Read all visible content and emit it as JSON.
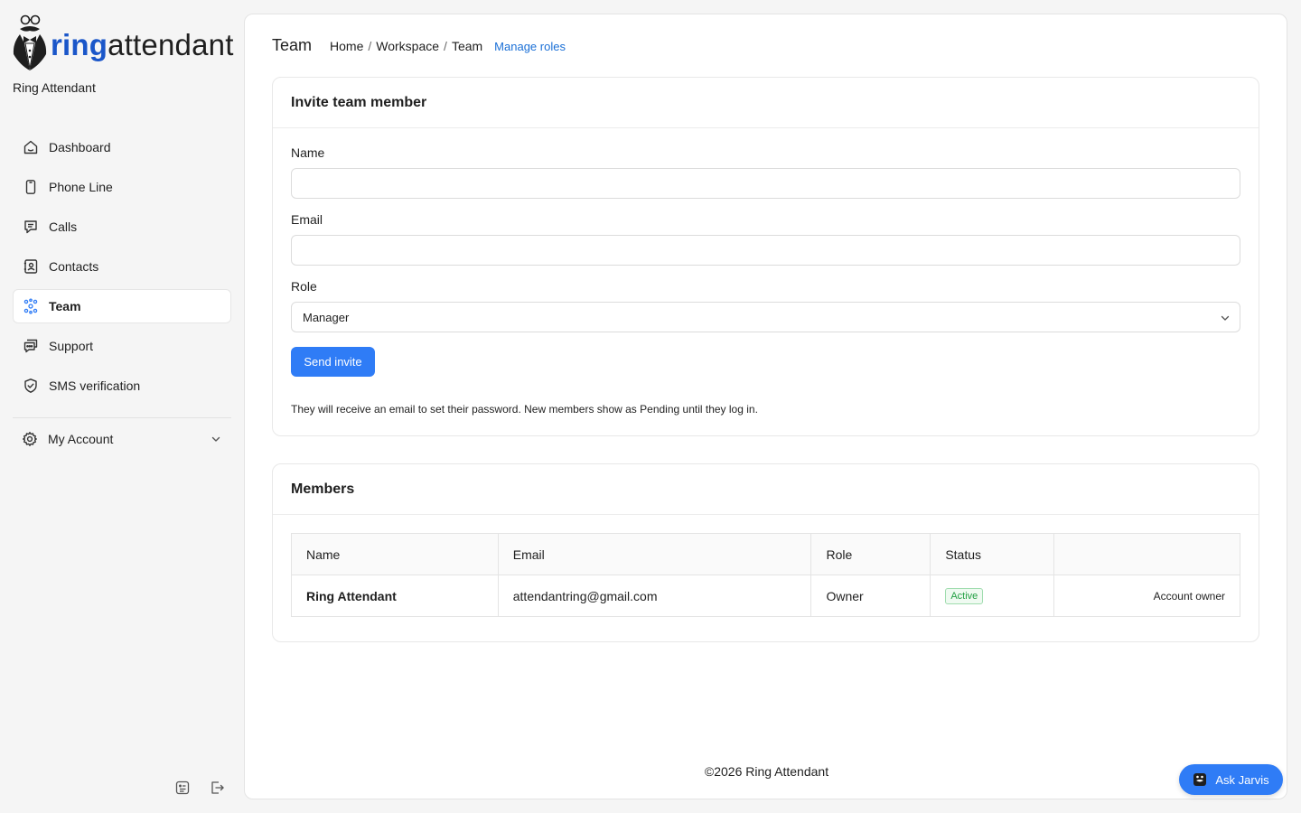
{
  "brand": {
    "logo_text_ring": "ring",
    "logo_text_attendant": "attendant",
    "org_name": "Ring Attendant",
    "accent_color": "#1a56c9"
  },
  "sidebar": {
    "items": [
      {
        "label": "Dashboard",
        "icon": "home-icon",
        "active": false
      },
      {
        "label": "Phone Line",
        "icon": "phone-icon",
        "active": false
      },
      {
        "label": "Calls",
        "icon": "message-icon",
        "active": false
      },
      {
        "label": "Contacts",
        "icon": "contact-icon",
        "active": false
      },
      {
        "label": "Team",
        "icon": "team-icon",
        "active": true
      },
      {
        "label": "Support",
        "icon": "support-icon",
        "active": false
      },
      {
        "label": "SMS verification",
        "icon": "shield-check-icon",
        "active": false
      }
    ],
    "account_label": "My Account",
    "bottom_icons": [
      "theme-icon",
      "logout-icon"
    ]
  },
  "header": {
    "title": "Team",
    "breadcrumbs": [
      "Home",
      "Workspace",
      "Team"
    ],
    "manage_roles": "Manage roles"
  },
  "invite": {
    "title": "Invite team member",
    "name_label": "Name",
    "name_value": "",
    "email_label": "Email",
    "email_value": "",
    "role_label": "Role",
    "role_value": "Manager",
    "send_label": "Send invite",
    "help_text": "They will receive an email to set their password. New members show as Pending until they log in."
  },
  "members": {
    "title": "Members",
    "columns": [
      "Name",
      "Email",
      "Role",
      "Status",
      ""
    ],
    "rows": [
      {
        "name": "Ring Attendant",
        "email": "attendantring@gmail.com",
        "role": "Owner",
        "status": "Active",
        "note": "Account owner"
      }
    ]
  },
  "footer": {
    "copyright": "©2026 Ring Attendant"
  },
  "assistant": {
    "label": "Ask Jarvis",
    "color": "#2f7cf6"
  }
}
